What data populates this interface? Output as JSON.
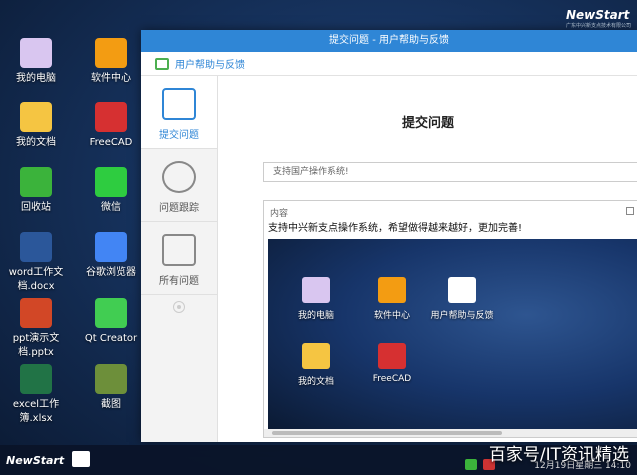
{
  "brand": {
    "name": "NewStart",
    "tagline": "广东中兴新支点技术有限公司"
  },
  "desktop": {
    "icons": [
      {
        "label": "我的电脑",
        "color": "#d9c6f0"
      },
      {
        "label": "软件中心",
        "color": "#f39c12"
      },
      {
        "label": "我的文档",
        "color": "#f5c542"
      },
      {
        "label": "FreeCAD",
        "color": "#d63031"
      },
      {
        "label": "回收站",
        "color": "#3bb33b"
      },
      {
        "label": "微信",
        "color": "#2ecc40"
      },
      {
        "label": "word工作文档.docx",
        "color": "#2b579a"
      },
      {
        "label": "谷歌浏览器",
        "color": "#4285f4"
      },
      {
        "label": "ppt演示文档.pptx",
        "color": "#d24726"
      },
      {
        "label": "Qt Creator",
        "color": "#41cd52"
      },
      {
        "label": "excel工作簿.xlsx",
        "color": "#217346"
      },
      {
        "label": "截图",
        "color": "#6d8f3a"
      }
    ]
  },
  "window": {
    "title": "提交问题 - 用户帮助与反馈",
    "toolbar_label": "用户帮助与反馈",
    "nav": [
      {
        "label": "提交问题",
        "icon": "submit-issue-icon"
      },
      {
        "label": "问题跟踪",
        "icon": "track-issue-icon"
      },
      {
        "label": "所有问题",
        "icon": "all-issues-icon"
      }
    ],
    "heading": "提交问题",
    "subject_value": "支持国产操作系统!",
    "content_label": "内容",
    "content_text": "支持中兴新支点操作系统，希望做得越来越好，更加完善!",
    "inner_icons": [
      {
        "label": "我的电脑",
        "color": "#d9c6f0"
      },
      {
        "label": "软件中心",
        "color": "#f39c12"
      },
      {
        "label": "用户帮助与反馈",
        "color": "#fff"
      },
      {
        "label": "我的文档",
        "color": "#f5c542"
      },
      {
        "label": "FreeCAD",
        "color": "#d63031"
      }
    ]
  },
  "taskbar": {
    "start_label": "NewStart",
    "clock": "12月19日星期三 14:10"
  },
  "watermark": "百家号/IT资讯精选"
}
